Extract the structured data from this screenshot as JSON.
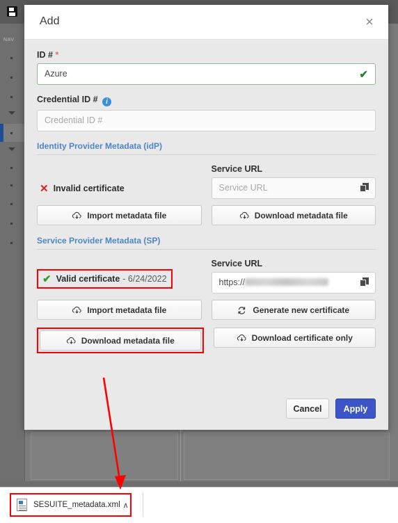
{
  "background": {
    "sidebar": {
      "save_icon": "save-icon",
      "nav_label": "NAV"
    }
  },
  "modal": {
    "title": "Add",
    "close_label": "×",
    "fields": {
      "id": {
        "label": "ID #",
        "required_marker": "*",
        "value": "Azure",
        "valid_mark": "✔"
      },
      "credential_id": {
        "label": "Credential ID #",
        "info_marker": "i",
        "value": "",
        "placeholder": "Credential ID #"
      }
    },
    "idp_section": {
      "title": "Identity Provider Metadata (idP)",
      "certificate": {
        "mark": "✕",
        "status": "Invalid certificate",
        "date": ""
      },
      "service_url": {
        "label": "Service URL",
        "value": "",
        "placeholder": "Service URL",
        "copy_icon": "copy-icon"
      },
      "buttons": [
        {
          "label": "Import metadata file",
          "icon": "cloud-upload-icon"
        },
        {
          "label": "Download metadata file",
          "icon": "cloud-download-icon"
        }
      ]
    },
    "sp_section": {
      "title": "Service Provider Metadata (SP)",
      "certificate": {
        "mark": "✔",
        "status": "Valid certificate",
        "date": "- 6/24/2022"
      },
      "service_url": {
        "label": "Service URL",
        "value": "https://",
        "placeholder": "",
        "copy_icon": "copy-icon"
      },
      "buttons": [
        {
          "label": "Import metadata file",
          "icon": "cloud-upload-icon"
        },
        {
          "label": "Generate new certificate",
          "icon": "refresh-icon"
        },
        {
          "label": "Download metadata file",
          "icon": "cloud-download-icon"
        },
        {
          "label": "Download certificate only",
          "icon": "cloud-download-icon"
        }
      ]
    },
    "footer": {
      "cancel_label": "Cancel",
      "apply_label": "Apply"
    }
  },
  "download_bar": {
    "file_name": "SESUITE_metadata.xml",
    "caret": "∧",
    "file_icon": "xml-file-icon"
  },
  "colors": {
    "accent_blue": "#3b55c6",
    "section_blue": "#4f86c6",
    "valid_green": "#3a9a3a",
    "invalid_red": "#e02020",
    "highlight_red": "#ff0000",
    "modal_bg": "#e9e9e9",
    "app_bg": "#7c7c7c"
  },
  "annotations": {
    "arrow_color": "#ff0000",
    "highlight_boxes": [
      "valid-certificate-status",
      "sp-download-metadata-file-button",
      "downloaded-file-item"
    ]
  }
}
